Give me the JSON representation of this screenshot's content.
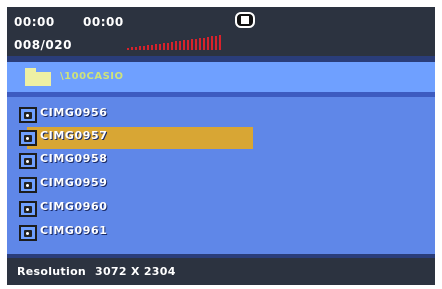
{
  "status": {
    "time_elapsed": "00:00",
    "time_total": "00:00",
    "counter": "008/020",
    "record_icon": "stop-icon",
    "level_color": "#d8222b"
  },
  "folder": {
    "label": "\\100CASIO",
    "icon": "folder-icon"
  },
  "files": [
    {
      "name": "CIMG0956",
      "icon": "camera-icon",
      "selected": false
    },
    {
      "name": "CIMG0957",
      "icon": "camera-icon",
      "selected": true
    },
    {
      "name": "CIMG0958",
      "icon": "camera-icon",
      "selected": false
    },
    {
      "name": "CIMG0959",
      "icon": "camera-icon",
      "selected": false
    },
    {
      "name": "CIMG0960",
      "icon": "camera-icon",
      "selected": false
    },
    {
      "name": "CIMG0961",
      "icon": "camera-icon",
      "selected": false
    }
  ],
  "footer": {
    "label": "Resolution",
    "value": "3072 X 2304"
  },
  "colors": {
    "screen": "#5f87e8",
    "bar": "#2c3340",
    "highlight": "#d8a634"
  }
}
